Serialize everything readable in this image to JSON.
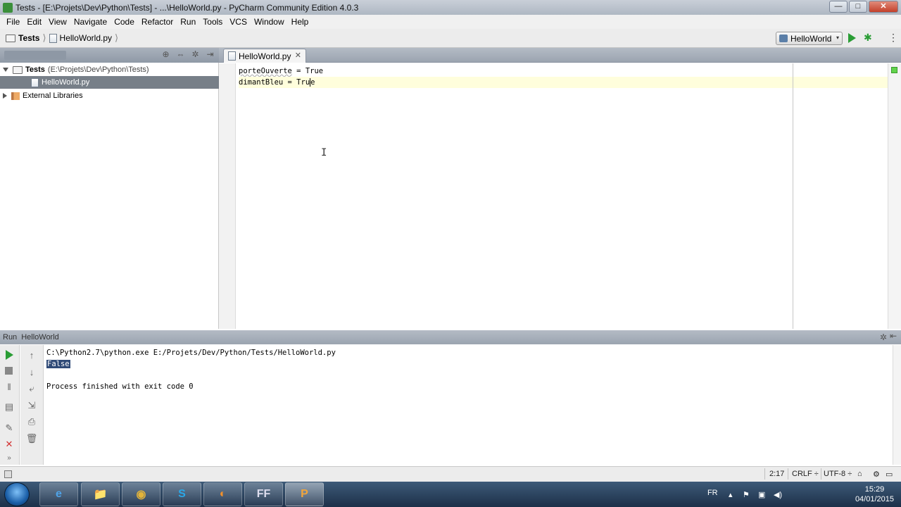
{
  "window": {
    "title": "Tests - [E:\\Projets\\Dev\\Python\\Tests] - ...\\HelloWorld.py - PyCharm Community Edition 4.0.3",
    "minimize": "—",
    "maximize": "□",
    "close": "✕"
  },
  "menu": [
    "File",
    "Edit",
    "View",
    "Navigate",
    "Code",
    "Refactor",
    "Run",
    "Tools",
    "VCS",
    "Window",
    "Help"
  ],
  "breadcrumb": {
    "project": "Tests",
    "file": "HelloWorld.py",
    "separator": "⟩"
  },
  "run_config": {
    "name": "HelloWorld",
    "dropdown": "▾"
  },
  "project_panel": {
    "tree": [
      {
        "label": "Tests",
        "detail": "(E:\\Projets\\Dev\\Python\\Tests)"
      },
      {
        "label": "HelloWorld.py"
      },
      {
        "label": "External Libraries"
      }
    ]
  },
  "editor": {
    "tab_label": "HelloWorld.py",
    "tab_close": "✕",
    "lines": [
      {
        "var": "porteOuverte",
        "rest": " = True"
      },
      {
        "var": "dimantBleu",
        "rest": " = Tru",
        "after_caret": "e"
      }
    ]
  },
  "run_panel": {
    "label": "Run",
    "config": "HelloWorld",
    "console": {
      "command": "C:\\Python2.7\\python.exe E:/Projets/Dev/Python/Tests/HelloWorld.py",
      "output": "False",
      "exit": "Process finished with exit code 0"
    }
  },
  "status": {
    "position": "2:17",
    "line_sep": "CRLF ÷",
    "encoding": "UTF-8 ÷"
  },
  "taskbar": {
    "apps": [
      "e",
      "📁",
      "◉",
      "S",
      "◐",
      "FF",
      "P"
    ],
    "language": "FR",
    "time": "15:29",
    "date": "04/01/2015"
  },
  "colors": {
    "accent_green": "#2a9d35",
    "selection": "#777f88",
    "current_line": "#fffedc"
  }
}
